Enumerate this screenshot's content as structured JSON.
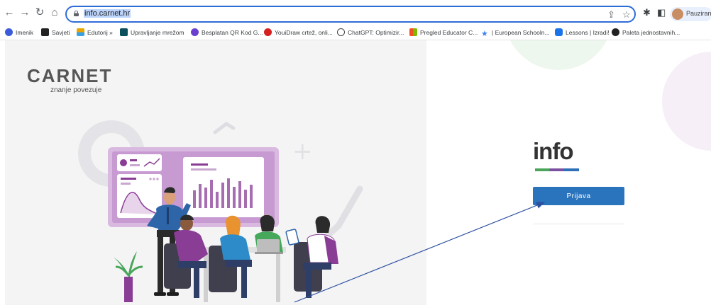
{
  "browser": {
    "url": "info.carnet.hr",
    "profile_name": "Pauziranc"
  },
  "bookmarks": [
    {
      "label": "Imenik",
      "color": "#3b5bdb"
    },
    {
      "label": "Savjeti",
      "color": "#222222"
    },
    {
      "label": "Edutorij »",
      "color": "#e8a400"
    },
    {
      "label": "Upravljanje mrežom",
      "color": "#0b4f5c"
    },
    {
      "label": "Besplatan QR Kod G...",
      "color": "#6a3fd0"
    },
    {
      "label": "YouiDraw crtež, onli...",
      "color": "#d62020"
    },
    {
      "label": "ChatGPT: Optimizir...",
      "color": "#444444"
    },
    {
      "label": "Pregled Educator C...",
      "color": "#f25022"
    },
    {
      "label": "| European Schooln...",
      "color": "#3b82f6"
    },
    {
      "label": "Lessons | Izradi!",
      "color": "#1a73e8"
    },
    {
      "label": "Paleta jednostavnih...",
      "color": "#222222"
    }
  ],
  "page": {
    "brand_name": "CARNET",
    "tagline": "znanje povezuje",
    "app_logo": "info",
    "login_button": "Prijava"
  },
  "colors": {
    "accent": "#2a74be",
    "logo_green": "#4aa55a",
    "logo_purple": "#7c4fa1",
    "annotation_arrow": "#2c4fa0"
  },
  "icons": [
    "back-icon",
    "forward-icon",
    "reload-icon",
    "home-icon",
    "lock-icon",
    "share-icon",
    "star-icon",
    "extensions-icon",
    "sidepanel-icon"
  ]
}
